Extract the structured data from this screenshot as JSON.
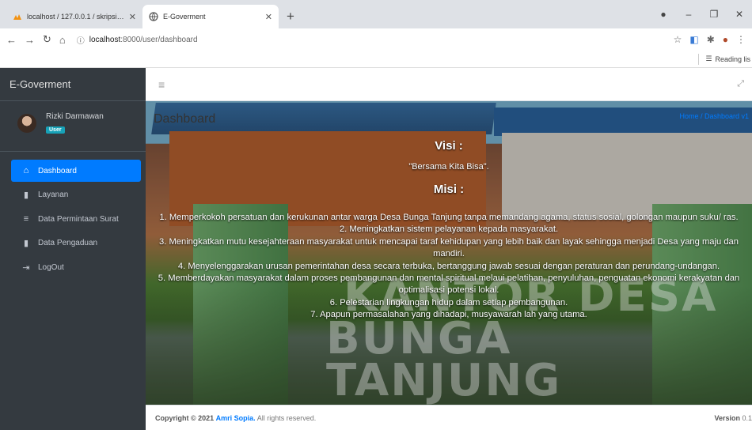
{
  "browser": {
    "tabs": [
      {
        "title": "localhost / 127.0.0.1 / skripsi_amr",
        "icon": "phpmyadmin-icon"
      },
      {
        "title": "E-Goverment",
        "icon": "globe-icon"
      }
    ],
    "url_host": "localhost",
    "url_path": ":8000/user/dashboard",
    "reading_list": "Reading lis"
  },
  "sidebar": {
    "brand": "E-Goverment",
    "user_name": "Rizki Darmawan",
    "user_role": "User",
    "items": [
      {
        "label": "Dashboard",
        "icon": "home-icon",
        "active": true
      },
      {
        "label": "Layanan",
        "icon": "file-icon",
        "active": false
      },
      {
        "label": "Data Permintaan Surat",
        "icon": "list-icon",
        "active": false
      },
      {
        "label": "Data Pengaduan",
        "icon": "file-icon",
        "active": false
      },
      {
        "label": "LogOut",
        "icon": "logout-icon",
        "active": false
      }
    ]
  },
  "page": {
    "title": "Dashboard",
    "breadcrumb": "Home / Dashboard v1"
  },
  "hero": {
    "visi_heading": "Visi :",
    "visi_text": "\"Bersama Kita Bisa\".",
    "misi_heading": "Misi :",
    "misi": [
      "1. Memperkokoh persatuan dan kerukunan antar warga Desa Bunga Tanjung tanpa memandang agama, status sosial, golongan maupun suku/ ras.",
      "2. Meningkatkan sistem pelayanan kepada masyarakat.",
      "3. Meningkatkan mutu kesejahteraan masyarakat untuk mencapai taraf kehidupan yang lebih baik dan layak sehingga menjadi Desa yang maju dan mandiri.",
      "4. Menyelenggarakan urusan pemerintahan desa secara terbuka, bertanggung jawab sesuai dengan peraturan dan perundang-undangan.",
      "5. Memberdayakan masyarakat dalam proses pembangunan dan mental spiritual melaui pelatihan, penyuluhan, penguatan ekonomi kerakyatan dan optimalisasi potensi lokal.",
      "6. Pelestarian lingkungan hidup dalam setiap pembangunan.",
      "7. Apapun permasalahan yang dihadapi, musyawarah lah yang utama."
    ],
    "sign_line1": "KANTOR DESA",
    "sign_line2": "BUNGA TANJUNG"
  },
  "footer": {
    "copyright_prefix": "Copyright © 2021",
    "author": "Amri Sopia.",
    "rights": "All rights reserved.",
    "version_label": "Version",
    "version": "0.1"
  }
}
